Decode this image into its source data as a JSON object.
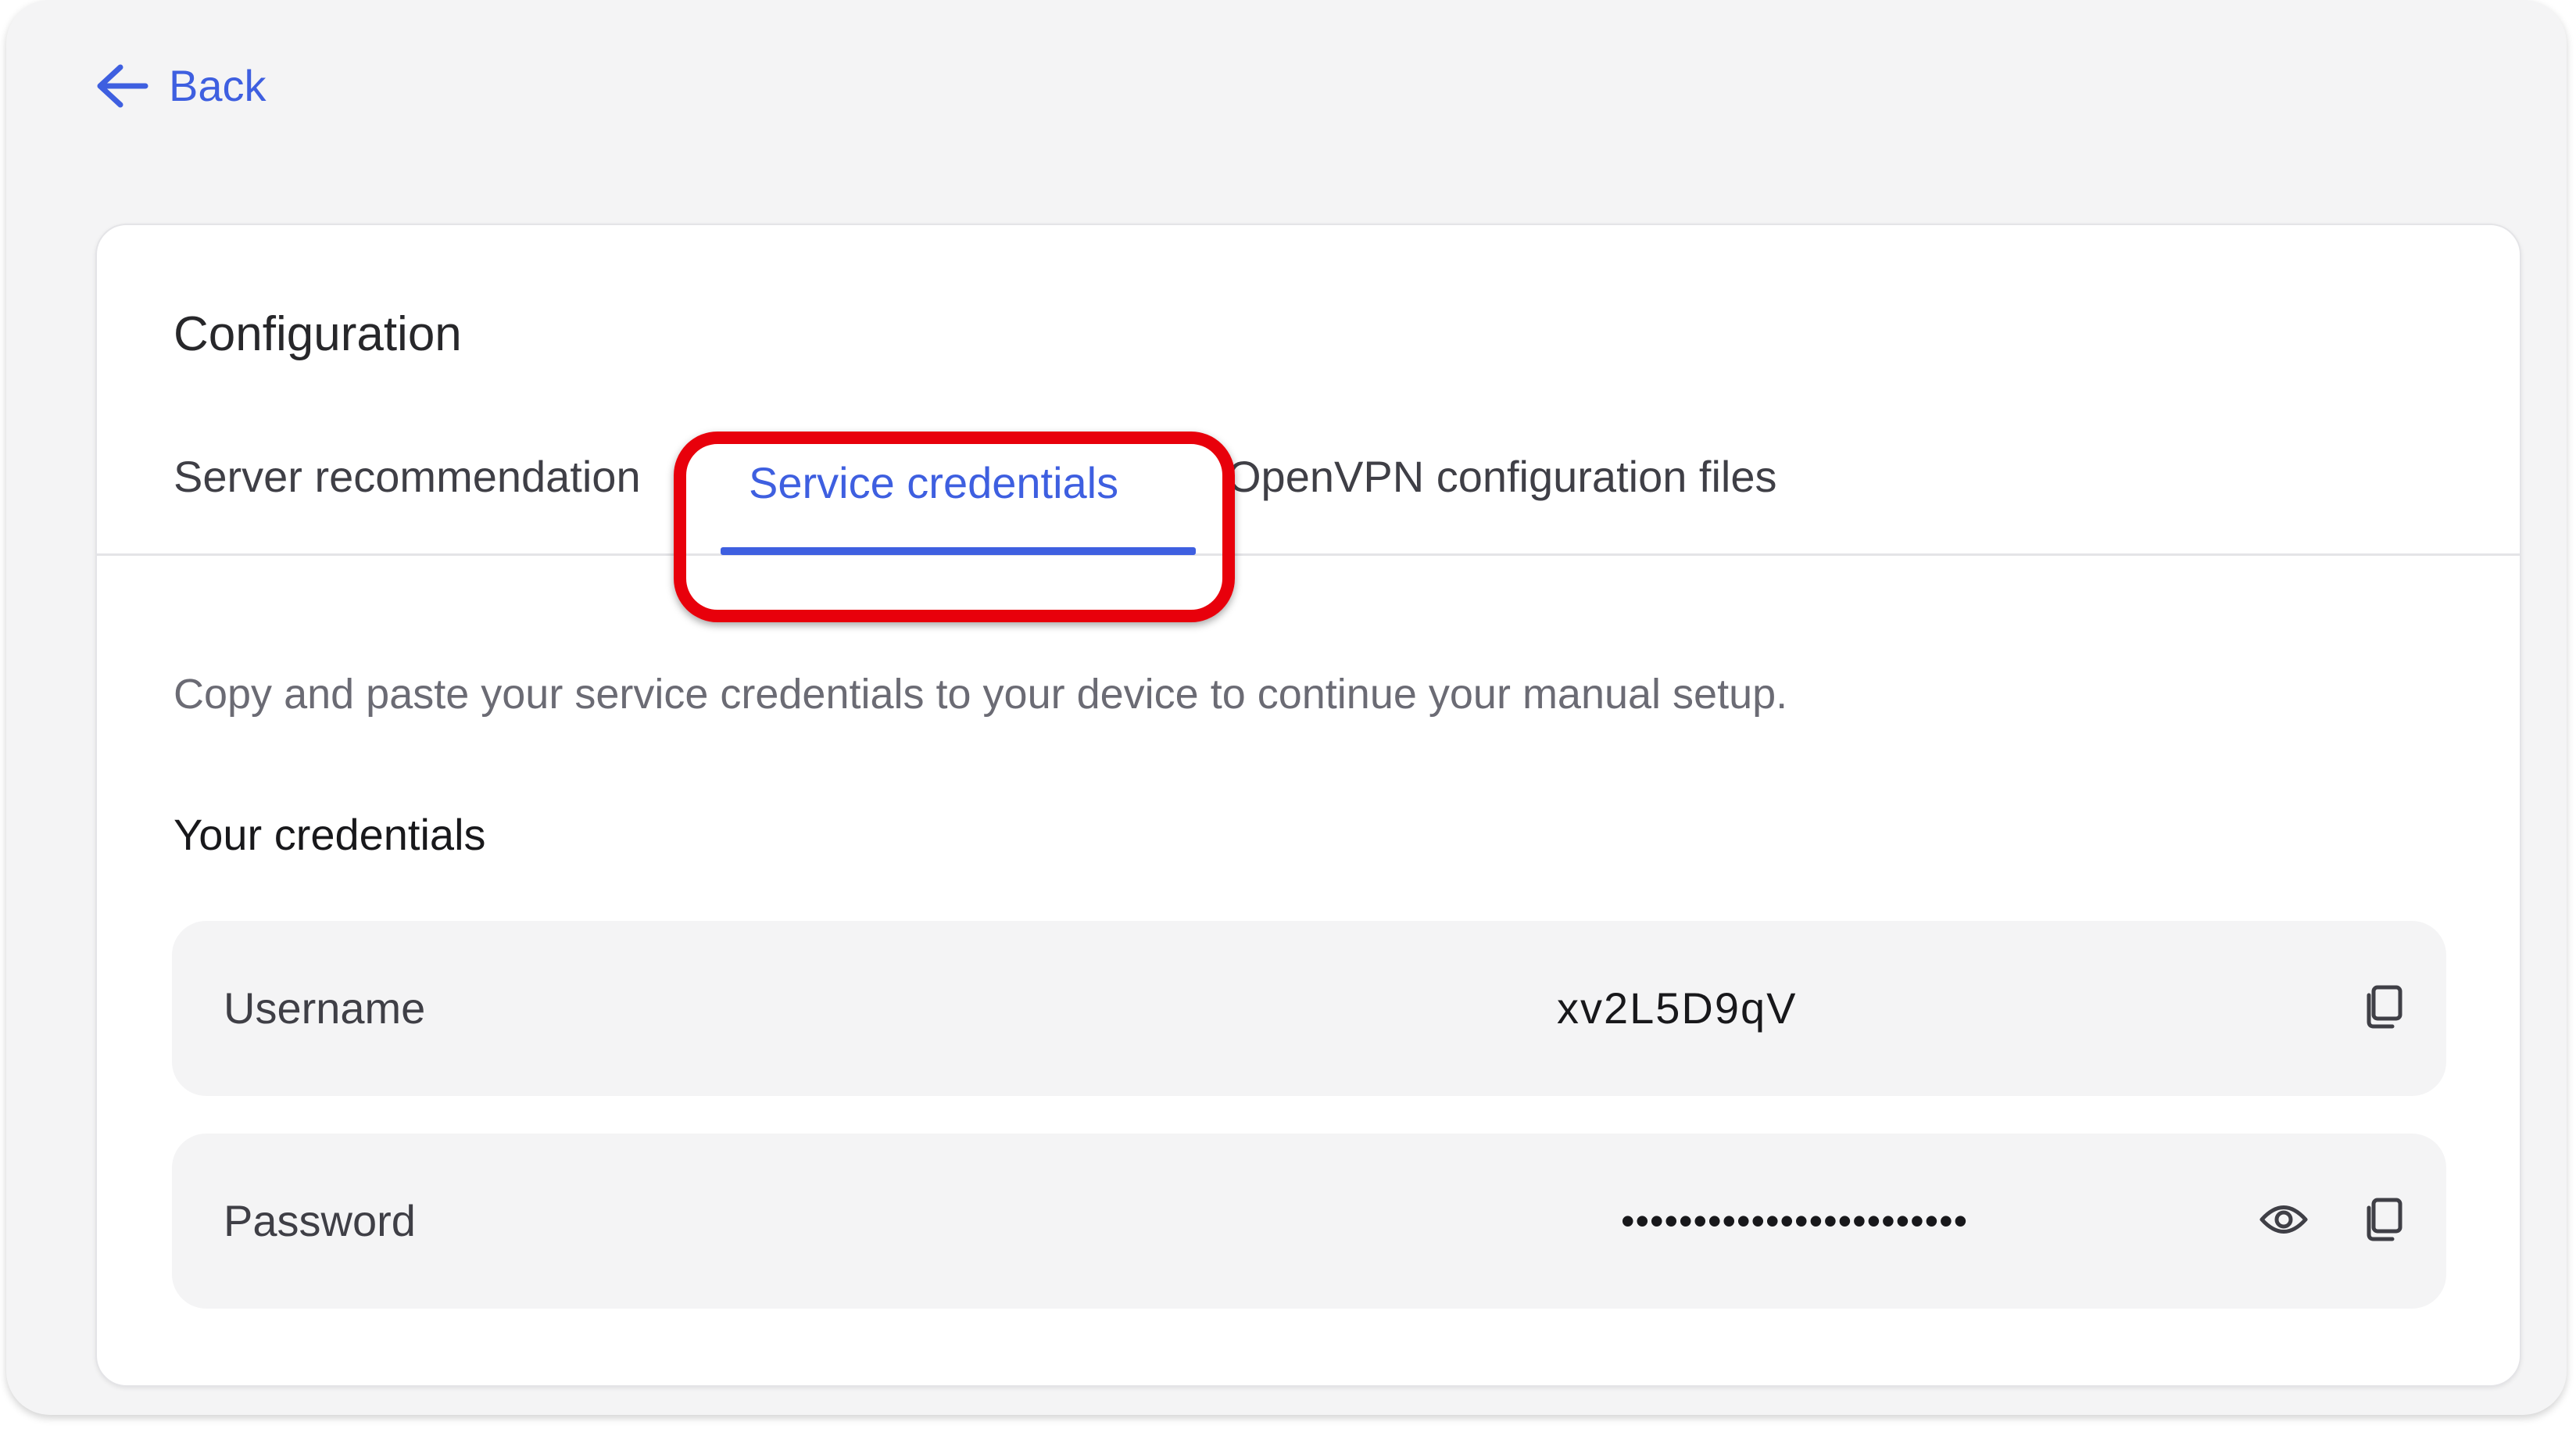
{
  "back": {
    "label": "Back"
  },
  "card": {
    "title": "Configuration",
    "tabs": [
      {
        "label": "Server recommendation",
        "active": false
      },
      {
        "label": "Service credentials",
        "active": true
      },
      {
        "label": "OpenVPN configuration files",
        "active": false
      }
    ],
    "description": "Copy and paste your service credentials to your device to continue your manual setup.",
    "subheading": "Your credentials",
    "credentials": {
      "username": {
        "label": "Username",
        "value": "xv2L5D9qV"
      },
      "password": {
        "label": "Password",
        "value": "••••••••••••••••••••••••"
      }
    }
  },
  "icons": {
    "back": "arrow-left-icon",
    "copy": "copy-icon",
    "reveal": "eye-icon"
  },
  "colors": {
    "accent": "#3e5fe0",
    "highlight": "#e8000b",
    "window_bg": "#f4f4f5",
    "card_bg": "#ffffff"
  }
}
